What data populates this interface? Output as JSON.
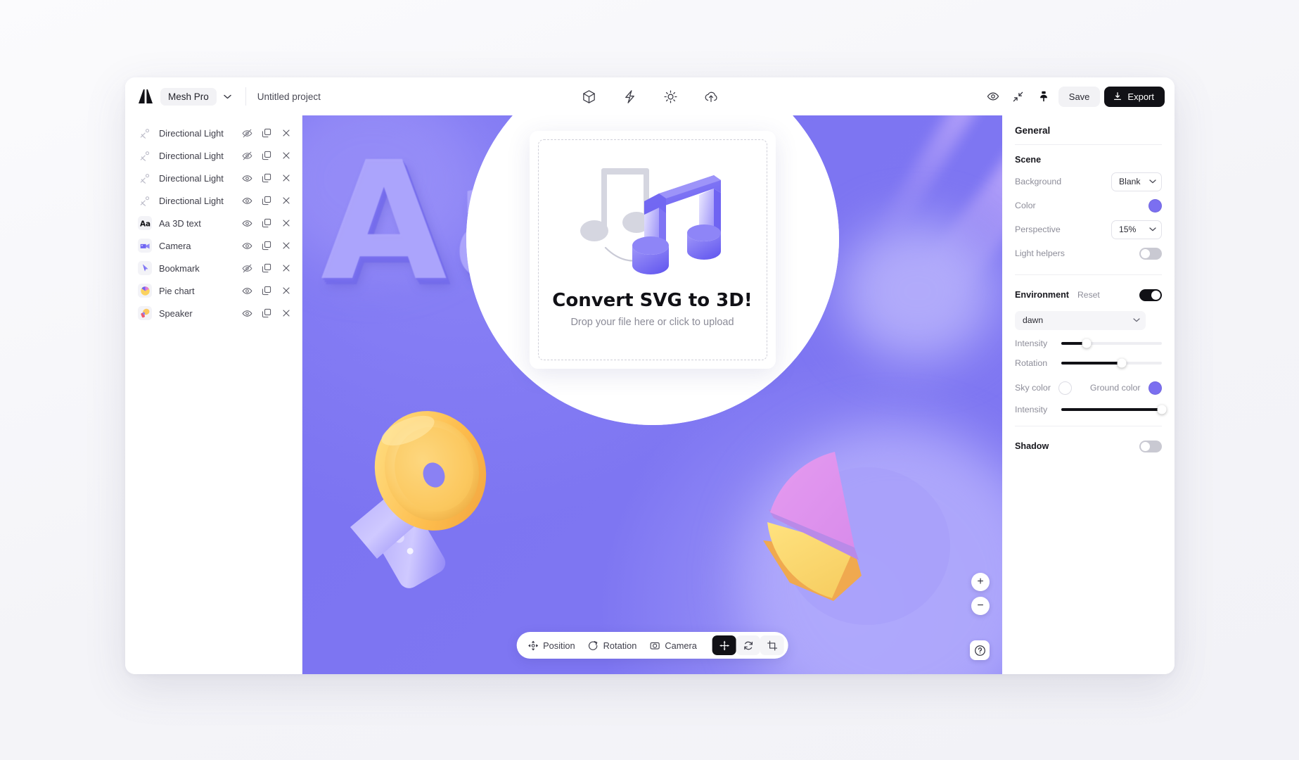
{
  "header": {
    "logo_icon": "mesh-logo-icon",
    "brand": "Mesh Pro",
    "brand_caret_icon": "chevron-down-icon",
    "project_name": "Untitled project",
    "tools": [
      {
        "name": "cube-icon",
        "label": "3D object"
      },
      {
        "name": "bolt-icon",
        "label": "Effects"
      },
      {
        "name": "sun-icon",
        "label": "Lighting"
      },
      {
        "name": "cloud-upload-icon",
        "label": "Upload"
      }
    ],
    "right_icons": [
      {
        "name": "eye-icon",
        "label": "Preview"
      },
      {
        "name": "collapse-arrows-icon",
        "label": "Collapse"
      },
      {
        "name": "pin-icon",
        "label": "Pin"
      }
    ],
    "save_label": "Save",
    "export_label": "Export",
    "export_icon": "download-icon"
  },
  "layers": {
    "items": [
      {
        "name": "Directional Light",
        "icon": "light-rays-icon",
        "visible": false,
        "thumb": "plain"
      },
      {
        "name": "Directional Light",
        "icon": "light-rays-icon",
        "visible": false,
        "thumb": "plain"
      },
      {
        "name": "Directional Light",
        "icon": "light-rays-icon",
        "visible": true,
        "thumb": "plain"
      },
      {
        "name": "Directional Light",
        "icon": "light-rays-icon",
        "visible": true,
        "thumb": "plain"
      },
      {
        "name": "Aa 3D text",
        "icon": "text-aa-icon",
        "visible": true,
        "thumb": "tinted"
      },
      {
        "name": "Camera",
        "icon": "camera-icon",
        "visible": true,
        "thumb": "tinted"
      },
      {
        "name": "Bookmark",
        "icon": "bookmark-icon",
        "visible": false,
        "thumb": "tinted"
      },
      {
        "name": "Pie chart",
        "icon": "pie-chart-icon",
        "visible": true,
        "thumb": "tinted"
      },
      {
        "name": "Speaker",
        "icon": "speaker-icon",
        "visible": true,
        "thumb": "tinted"
      }
    ],
    "duplicate_icon": "duplicate-icon",
    "delete_icon": "close-icon",
    "visible_icon": "eye-icon",
    "hidden_icon": "eye-off-icon"
  },
  "upload_modal": {
    "title": "Convert SVG to 3D!",
    "subtitle": "Drop your file here or click to upload",
    "artwork": "music-note-3d-illustration"
  },
  "bottom_bar": {
    "items": [
      {
        "label": "Position",
        "icon": "move-target-icon"
      },
      {
        "label": "Rotation",
        "icon": "rotate-icon"
      },
      {
        "label": "Camera",
        "icon": "camera-shutter-icon"
      }
    ],
    "buttons": [
      {
        "name": "pan-tool-button",
        "icon": "move-arrows-icon",
        "active": true
      },
      {
        "name": "orbit-tool-button",
        "icon": "refresh-icon",
        "active": false
      },
      {
        "name": "crop-tool-button",
        "icon": "crop-icon",
        "active": false
      }
    ]
  },
  "canvas": {
    "zoom_in_label": "+",
    "zoom_out_label": "−",
    "help_label": "?",
    "aa_text": "Aa",
    "background_color": "#7b73f0"
  },
  "right_panel": {
    "title": "General",
    "scene_title": "Scene",
    "background_label": "Background",
    "background_value": "Blank",
    "color_label": "Color",
    "color_value": "#7b6ff0",
    "perspective_label": "Perspective",
    "perspective_value": "15%",
    "light_helpers_label": "Light helpers",
    "light_helpers_on": false,
    "environment_label": "Environment",
    "reset_label": "Reset",
    "environment_on": true,
    "environment_preset": "dawn",
    "intensity_label": "Intensity",
    "intensity_value": 25,
    "rotation_label": "Rotation",
    "rotation_value": 60,
    "sky_color_label": "Sky color",
    "sky_color_value": "#ffffff",
    "ground_color_label": "Ground color",
    "ground_color_value": "#7b6ff0",
    "intensity2_label": "Intensity",
    "intensity2_value": 100,
    "shadow_label": "Shadow",
    "shadow_on": false,
    "chevron_icon": "chevron-down-icon"
  }
}
